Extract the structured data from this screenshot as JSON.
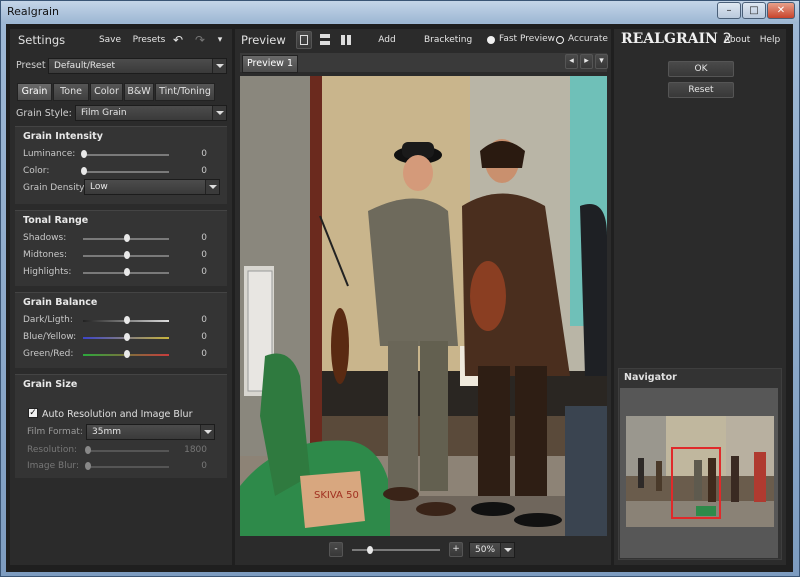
{
  "window": {
    "title": "Realgrain"
  },
  "settings": {
    "title": "Settings",
    "save": "Save",
    "presets": "Presets",
    "preset_label": "Preset",
    "preset_value": "Default/Reset",
    "tabs": [
      "Grain",
      "Tone",
      "Color",
      "B&W",
      "Tint/Toning"
    ],
    "grain_style_label": "Grain Style:",
    "grain_style_value": "Film Grain",
    "grain_intensity": {
      "title": "Grain Intensity",
      "luminance": {
        "label": "Luminance:",
        "value": "0"
      },
      "color": {
        "label": "Color:",
        "value": "0"
      },
      "density_label": "Grain Density",
      "density_value": "Low"
    },
    "tonal_range": {
      "title": "Tonal Range",
      "shadows": {
        "label": "Shadows:",
        "value": "0"
      },
      "midtones": {
        "label": "Midtones:",
        "value": "0"
      },
      "highlights": {
        "label": "Highlights:",
        "value": "0"
      }
    },
    "grain_balance": {
      "title": "Grain Balance",
      "dark_light": {
        "label": "Dark/Ligth:",
        "value": "0"
      },
      "blue_yellow": {
        "label": "Blue/Yellow:",
        "value": "0"
      },
      "green_red": {
        "label": "Green/Red:",
        "value": "0"
      }
    },
    "grain_size": {
      "title": "Grain Size",
      "auto_label": "Auto Resolution and Image Blur",
      "film_format_label": "Film Format:",
      "film_format_value": "35mm",
      "resolution": {
        "label": "Resolution:",
        "value": "1800"
      },
      "image_blur": {
        "label": "Image Blur:",
        "value": "0"
      }
    }
  },
  "preview": {
    "title": "Preview",
    "add_preview": "Add Preview",
    "bracketing": "Bracketing",
    "fast_preview": "Fast Preview",
    "accurate": "Accurate",
    "tab_label": "Preview 1",
    "sign_text": "SKIVA 50",
    "zoom_minus": "-",
    "zoom_plus": "+",
    "zoom_value": "50%"
  },
  "right": {
    "brand_main": "REALGRAIN",
    "brand_num": "2",
    "about": "About",
    "help": "Help",
    "ok": "OK",
    "reset": "Reset",
    "navigator": "Navigator"
  }
}
